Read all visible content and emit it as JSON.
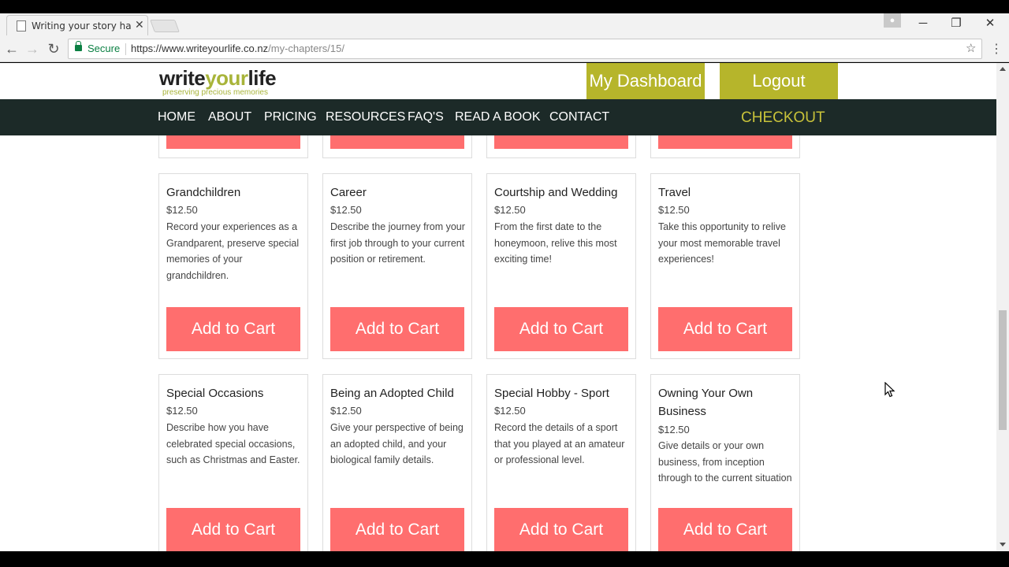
{
  "browser": {
    "tab_title": "Writing your story has ne",
    "secure_label": "Secure",
    "url_host": "https://www.writeyourlife.co.nz",
    "url_path": "/my-chapters/15/"
  },
  "site": {
    "logo_dark": "write",
    "logo_accent": "your",
    "logo_dark2": "life",
    "logo_tagline": "preserving precious memories",
    "dashboard_label": "My Dashboard",
    "logout_label": "Logout",
    "nav": [
      "HOME",
      "ABOUT",
      "PRICING",
      "RESOURCES",
      "FAQ'S",
      "READ A BOOK",
      "CONTACT"
    ],
    "checkout_label": "CHECKOUT"
  },
  "button_label": "Add to Cart",
  "chapters_row1": [
    {
      "title": "Grandchildren",
      "price": "$12.50",
      "desc": "Record your experiences as a Grandparent, preserve special memories of your grandchildren."
    },
    {
      "title": "Career",
      "price": "$12.50",
      "desc": "Describe the journey from your first job through to your current position or retirement."
    },
    {
      "title": "Courtship and Wedding",
      "price": "$12.50",
      "desc": "From the first date to the honeymoon, relive this most exciting time!"
    },
    {
      "title": "Travel",
      "price": "$12.50",
      "desc": "Take this opportunity to relive your most memorable travel experiences!"
    }
  ],
  "chapters_row2": [
    {
      "title": "Special Occasions",
      "price": "$12.50",
      "desc": "Describe how you have celebrated special occasions, such as Christmas and Easter."
    },
    {
      "title": "Being an Adopted Child",
      "price": "$12.50",
      "desc": "Give your perspective of being an adopted child, and your biological family details."
    },
    {
      "title": "Special Hobby - Sport",
      "price": "$12.50",
      "desc": "Record the details of a sport that you played at an amateur or professional level."
    },
    {
      "title": "Owning Your Own Business",
      "price": "$12.50",
      "desc": "Give details or your own business, from inception through to the current situation"
    }
  ],
  "colors": {
    "nav_bg": "#1c2a28",
    "accent": "#b6b52b",
    "cart_button": "#ff6e6e"
  }
}
